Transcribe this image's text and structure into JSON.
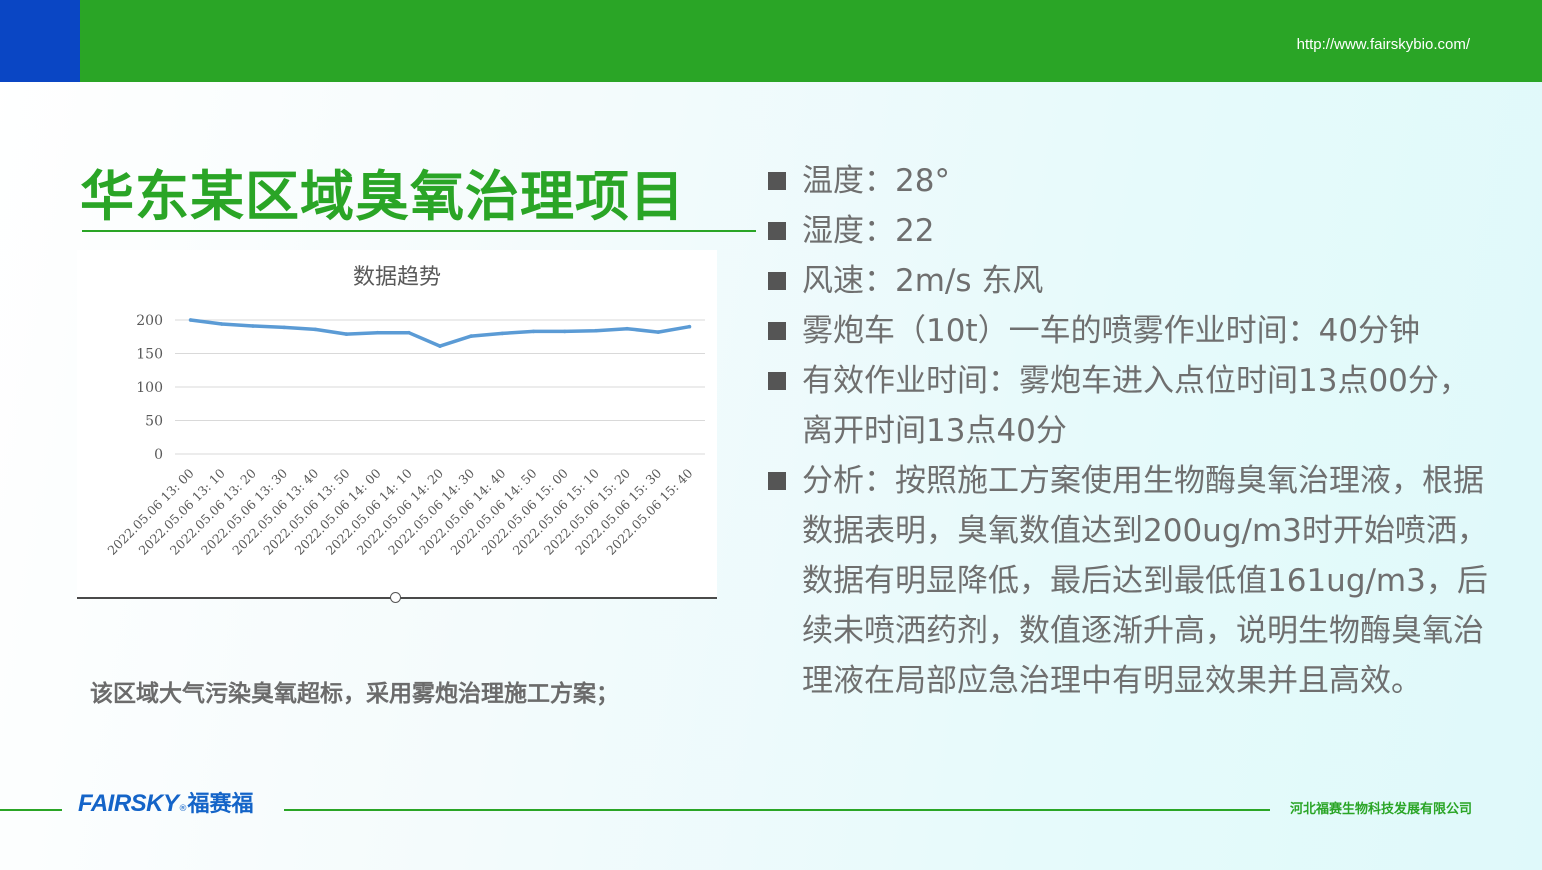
{
  "header": {
    "url": "http://www.fairskybio.com/"
  },
  "title": "华东某区域臭氧治理项目",
  "caption": "该区域大气污染臭氧超标，采用雾炮治理施工方案；",
  "bullets": [
    "温度：28°",
    "湿度：22",
    "风速：2m/s  东风",
    "雾炮车（10t）一车的喷雾作业时间：40分钟",
    "有效作业时间：雾炮车进入点位时间13点00分，离开时间13点40分",
    "分析：按照施工方案使用生物酶臭氧治理液，根据数据表明，臭氧数值达到200ug/m3时开始喷洒，数据有明显降低，最后达到最低值161ug/m3，后续未喷洒药剂，数值逐渐升高，说明生物酶臭氧治理液在局部应急治理中有明显效果并且高效。"
  ],
  "footer": {
    "logo_en": "FAIRSKY",
    "logo_reg": "®",
    "logo_cn": "福赛福",
    "company": "河北福赛生物科技发展有限公司"
  },
  "colors": {
    "brand_green": "#2aa526",
    "brand_blue": "#0a46c4",
    "line": "#5b9bd5"
  },
  "chart_data": {
    "type": "line",
    "title": "数据趋势",
    "ylim": [
      0,
      200
    ],
    "yticks": [
      0,
      50,
      100,
      150,
      200
    ],
    "grid": true,
    "categories": [
      "2022.05.06 13: 00",
      "2022.05.06 13: 10",
      "2022.05.06 13: 20",
      "2022.05.06 13: 30",
      "2022.05.06 13: 40",
      "2022.05.06 13: 50",
      "2022.05.06 14: 00",
      "2022.05.06 14: 10",
      "2022.05.06 14: 20",
      "2022.05.06 14: 30",
      "2022.05.06 14: 40",
      "2022.05.06 14: 50",
      "2022.05.06 15: 00",
      "2022.05.06 15: 10",
      "2022.05.06 15: 20",
      "2022.05.06 15: 30",
      "2022.05.06 15: 40"
    ],
    "values": [
      200,
      194,
      191,
      189,
      186,
      179,
      181,
      181,
      161,
      176,
      180,
      183,
      183,
      184,
      187,
      182,
      190
    ]
  }
}
